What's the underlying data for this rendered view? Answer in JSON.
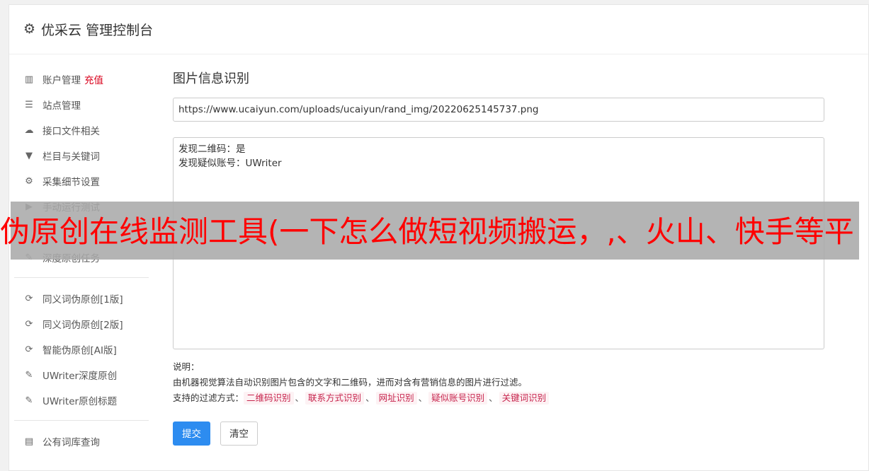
{
  "header": {
    "icon": "gear-icon",
    "title": "优采云 管理控制台"
  },
  "sidebar": {
    "group1": [
      {
        "label": "账户管理",
        "extra": "充值",
        "icon": "bar-chart-icon",
        "glyph": "▥"
      },
      {
        "label": "站点管理",
        "icon": "server-icon",
        "glyph": "☰"
      },
      {
        "label": "接口文件相关",
        "icon": "cloud-upload-icon",
        "glyph": "☁"
      },
      {
        "label": "栏目与关键词",
        "icon": "filter-icon",
        "glyph": "▼"
      },
      {
        "label": "采集细节设置",
        "icon": "cogs-icon",
        "glyph": "⚙"
      },
      {
        "label": "手动运行测试",
        "icon": "play-circle-icon",
        "glyph": "▶"
      },
      {
        "label": "",
        "icon": "hidden-item-icon",
        "glyph": ""
      },
      {
        "label": "深度原创任务",
        "icon": "edit-icon",
        "glyph": "✎"
      }
    ],
    "group2": [
      {
        "label": "同义词伪原创[1版]",
        "icon": "refresh-icon",
        "glyph": "⟳"
      },
      {
        "label": "同义词伪原创[2版]",
        "icon": "refresh-icon",
        "glyph": "⟳"
      },
      {
        "label": "智能伪原创[AI版]",
        "icon": "refresh-icon",
        "glyph": "⟳"
      },
      {
        "label": "UWriter深度原创",
        "icon": "edit-icon",
        "glyph": "✎"
      },
      {
        "label": "UWriter原创标题",
        "icon": "edit-icon",
        "glyph": "✎"
      }
    ],
    "group3": [
      {
        "label": "公有词库查询",
        "icon": "book-icon",
        "glyph": "▤"
      }
    ]
  },
  "main": {
    "title": "图片信息识别",
    "url_value": "https://www.ucaiyun.com/uploads/ucaiyun/rand_img/20220625145737.png",
    "result_lines": [
      "发现二维码：是",
      "发现疑似账号：UWriter"
    ],
    "desc_label": "说明：",
    "desc_text": "由机器视觉算法自动识别图片包含的文字和二维码，进而对含有营销信息的图片进行过滤。",
    "filters_label": "支持的过滤方式：",
    "filters": [
      "二维码识别",
      "联系方式识别",
      "网址识别",
      "疑似账号识别",
      "关键词识别"
    ],
    "separator": "、",
    "submit_label": "提交",
    "clear_label": "清空"
  },
  "overlay": {
    "text": "伪原创在线监测工具(一下怎么做短视频搬运，,、火山、快手等平"
  },
  "colors": {
    "primary": "#2d8cf0",
    "danger": "#d9001b",
    "overlay_text": "#ff0000"
  }
}
